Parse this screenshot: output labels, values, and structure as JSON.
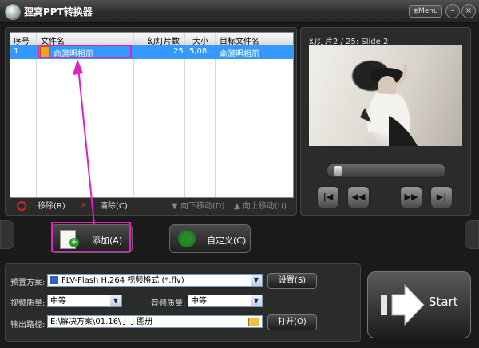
{
  "window": {
    "title": "狸窝PPT转换器",
    "menu_label": "Menu",
    "minimize_glyph": "–",
    "close_glyph": "×"
  },
  "file_list": {
    "columns": [
      "序号",
      "文件名",
      "幻灯片数",
      "大小",
      "目标文件名"
    ],
    "rows": [
      {
        "index": "1",
        "filename": "俞灏明相册",
        "slides": "25",
        "size": "5,08...",
        "target": "俞灏明相册"
      }
    ]
  },
  "list_toolbar": {
    "remove": "移除(R)",
    "clear": "清除(C)",
    "move_down": "向下移动(D)",
    "move_up": "向上移动(U)"
  },
  "preview": {
    "slide_label": "幻灯片2 / 25: Slide 2"
  },
  "buttons": {
    "add": "添加(A)",
    "custom": "自定义(C)",
    "start": "Start"
  },
  "settings": {
    "preset_label": "预置方案:",
    "preset_value": "FLV-Flash H.264 视频格式 (*.flv)",
    "settings_button": "设置(S)",
    "video_quality_label": "视频质量:",
    "video_quality_value": "中等",
    "audio_quality_label": "音频质量:",
    "audio_quality_value": "中等",
    "output_label": "输出路径:",
    "output_value": "E:\\解决方案\\01.16\\丁丁图册",
    "open_button": "打开(O)"
  },
  "colors": {
    "annotation": "#e020c0",
    "selection": "#3399ff"
  }
}
